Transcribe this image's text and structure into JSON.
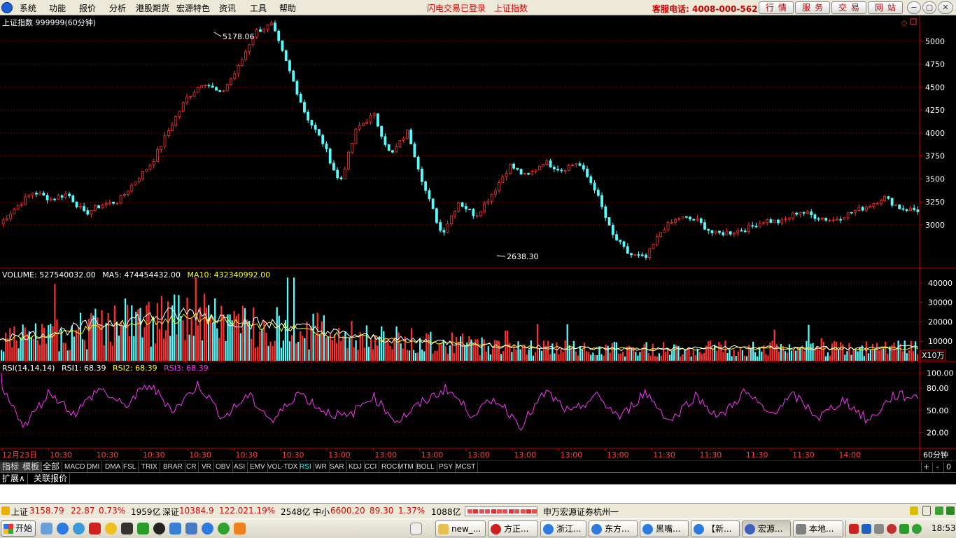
{
  "menu": {
    "items": [
      "系统",
      "功能",
      "报价",
      "分析",
      "港股期货",
      "宏源特色",
      "资讯",
      "工具",
      "帮助"
    ],
    "login_status": "闪电交易已登录",
    "current_stock": "上证指数",
    "phone": "客服电话: 4008-000-562",
    "quick_buttons": [
      "行情",
      "服务",
      "交易",
      "网站"
    ],
    "window_buttons": [
      "−",
      "▢",
      "⧉",
      "✕"
    ]
  },
  "main_chart": {
    "title": "上证指数 999999(60分钟)",
    "high_label": "5178.06",
    "low_label": "2638.30",
    "y_ticks": [
      "5000",
      "4750",
      "4500",
      "4250",
      "4000",
      "3750",
      "3500",
      "3250",
      "3000"
    ],
    "corner_icons": [
      "diamond-icon",
      "square-icon"
    ]
  },
  "volume_panel": {
    "label_volume": "VOLUME: 527540032.00",
    "label_ma5": "MA5: 474454432.00",
    "label_ma10": "MA10: 432340992.00",
    "y_ticks": [
      "40000",
      "30000",
      "20000",
      "10000"
    ],
    "unit": "X10万"
  },
  "rsi_panel": {
    "label_name": "RSI(14,14,14)",
    "label_rsi1": "RSI1: 68.39",
    "label_rsi2": "RSI2: 68.39",
    "label_rsi3": "RSI3: 68.39",
    "y_ticks": [
      "100.00",
      "80.00",
      "50.00",
      "20.00"
    ]
  },
  "x_axis": {
    "labels": [
      "12月23日",
      "10:30",
      "10:30",
      "10:30",
      "10:30",
      "10:30",
      "10:30",
      "13:00",
      "13:00",
      "13:00",
      "13:00",
      "13:00",
      "13:00",
      "13:00",
      "11:30",
      "11:30",
      "11:30",
      "11:30",
      "14:00"
    ],
    "period": "60分钟"
  },
  "indicator_tabs": [
    "指标",
    "模板",
    "全部",
    "MACD",
    "DMI",
    "DMA",
    "FSL",
    "TRIX",
    "BRAR",
    "CR",
    "VR",
    "OBV",
    "ASI",
    "EMV",
    "VOL-TDX",
    "RSI",
    "WR",
    "SAR",
    "KDJ",
    "CCI",
    "ROC",
    "MTM",
    "BOLL",
    "PSY",
    "MCST"
  ],
  "tab_controls": [
    "+",
    "-",
    "0"
  ],
  "ext_tabs": [
    "扩展∧",
    "关联报价"
  ],
  "ticker": {
    "sh_name": "上证",
    "sh_value": "3158.79",
    "sh_change": "22.87",
    "sh_pct": "0.73%",
    "sh_amount": "1959亿",
    "sz_name": "深证",
    "sz_value": "10384.9",
    "sz_change": "122.02",
    "sz_pct": "1.19%",
    "sz_amount": "2548亿",
    "zx_name": "中小",
    "zx_value": "6600.20",
    "zx_change": "89.30",
    "zx_pct": "1.37%",
    "zx_amount": "1088亿",
    "broker": "申万宏源证券杭州一"
  },
  "taskbar": {
    "start": "开始",
    "tasks": [
      "new_...",
      "方正...",
      "浙江...",
      "东方...",
      "黑嘴...",
      "【新...",
      "宏源...",
      "本地..."
    ],
    "clock": "18:53"
  },
  "colors": {
    "up": "#ff3030",
    "down": "#54ffff",
    "ma5": "#ffffff",
    "ma10": "#ffff00",
    "rsi": "#ff33ff",
    "grid": "#8b0000",
    "frame": "#c00000"
  },
  "chart_data": [
    {
      "type": "candlestick",
      "title": "上证指数 999999(60分钟)",
      "ylim": [
        2550,
        5250
      ],
      "series": [
        {
          "values": [
            3010,
            3200,
            3360,
            3280,
            3340,
            3120,
            3220,
            3260,
            3480,
            3690,
            4050,
            4380,
            4560,
            4420,
            4700,
            5100,
            5178,
            4700,
            4200,
            3900,
            3450,
            4050,
            4200,
            3750,
            4020,
            3400,
            2900,
            3250,
            3100,
            3350,
            3650,
            3520,
            3690,
            3600,
            3680,
            3400,
            2900,
            2680,
            2638,
            2960,
            3080,
            3050,
            2900,
            2920,
            2960,
            3050,
            3030,
            3150,
            3090,
            3050,
            3130,
            3200,
            3300,
            3180,
            3160
          ]
        }
      ],
      "annotations": [
        "5178.06",
        "2638.30"
      ]
    },
    {
      "type": "bar",
      "title": "VOLUME",
      "ylabel": "X10万",
      "ylim": [
        0,
        45000
      ],
      "series": [
        {
          "name": "MA5",
          "values": [
            12000,
            14000,
            19000,
            22000,
            25000,
            20000,
            18000,
            14000,
            11000,
            10000,
            8000,
            7000,
            6500,
            6000,
            6000,
            7000,
            6500,
            6500,
            6000,
            7000
          ]
        },
        {
          "name": "MA10",
          "values": [
            11000,
            13000,
            17000,
            20000,
            22000,
            19000,
            17000,
            13000,
            11000,
            9500,
            8000,
            7000,
            6500,
            6000,
            6000,
            6500,
            6300,
            6300,
            6000,
            6500
          ]
        }
      ]
    },
    {
      "type": "line",
      "title": "RSI(14,14,14)",
      "ylim": [
        0,
        110
      ],
      "series": [
        {
          "name": "RSI1",
          "values": [
            80,
            30,
            75,
            45,
            80,
            55,
            85,
            50,
            85,
            40,
            70,
            35,
            75,
            50,
            40,
            70,
            35,
            60,
            80,
            45,
            65,
            30,
            75,
            45,
            70,
            40,
            75,
            35,
            70,
            40,
            75,
            45,
            70,
            40,
            65,
            35,
            70,
            68
          ]
        }
      ]
    }
  ]
}
